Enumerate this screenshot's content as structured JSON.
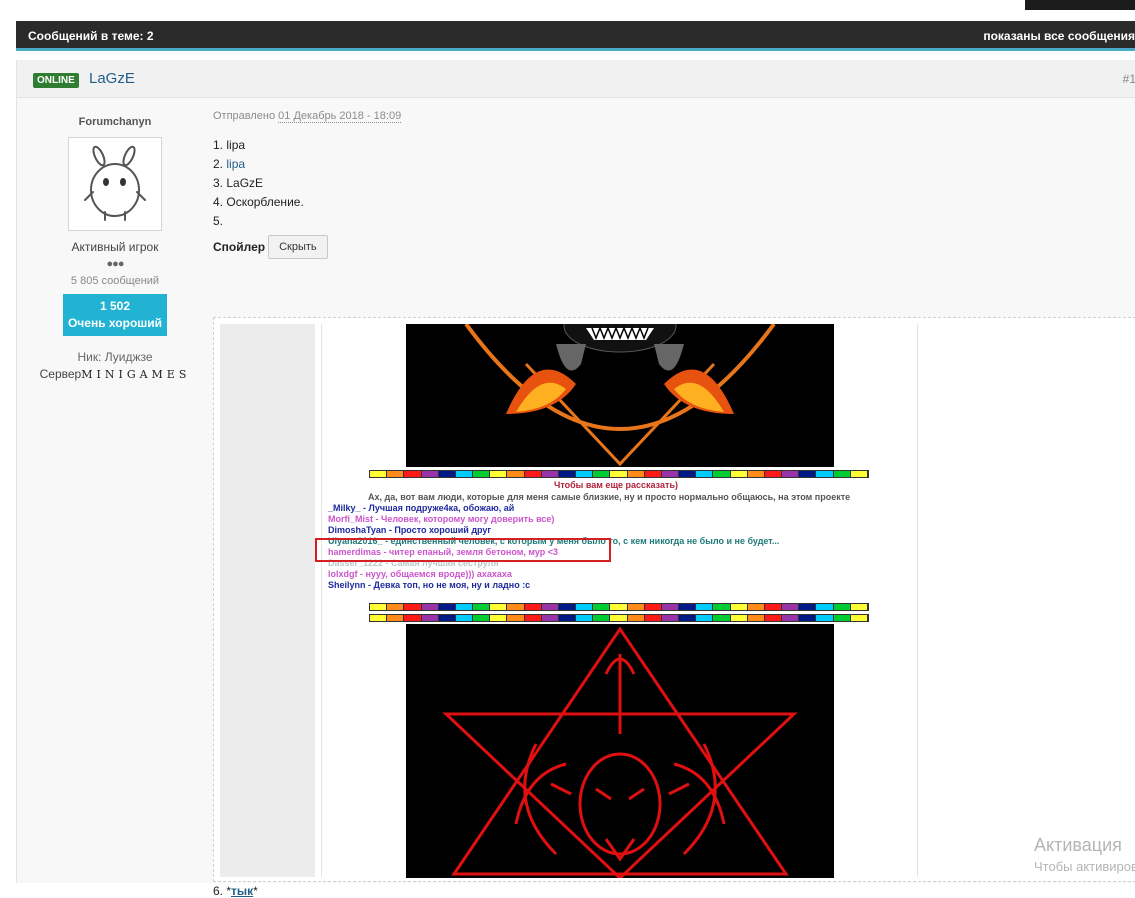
{
  "topbar": {
    "count_label": "Сообщений в теме: 2",
    "shown_label": "показаны все сообщения"
  },
  "post": {
    "status_badge": "ONLINE",
    "author": "LaGzE",
    "number": "#1",
    "sidebar": {
      "group": "Forumchanyn",
      "rank": "Активный игрок",
      "pips": "●●●",
      "posts_count": "5 805 сообщений",
      "reputation_value": "1 502",
      "reputation_label": "Очень хороший",
      "nick_label": "Ник:",
      "nick_value": "Луиджзе",
      "server_label": "Сервер",
      "server_value": "MINIGAMES"
    },
    "posted_label": "Отправлено",
    "posted_date": "01 Декабрь 2018 - 18:09",
    "list": {
      "item1_num": "1.",
      "item1_text": "lipa",
      "item2_num": "2.",
      "item2_text": "lipa",
      "item3_num": "3.",
      "item3_text": "LaGzE",
      "item4_num": "4.",
      "item4_text": "Оскорбление.",
      "item5_num": "5."
    },
    "spoiler_label": "Спойлер",
    "hide_button": "Скрыть",
    "spoiler": {
      "heading": "Чтобы вам еще рассказать)",
      "intro": "Ах, да, вот вам люди, которые для меня самые близкие, ну и просто нормально общаюсь, на этом проекте",
      "line1": "_Milky_ - Лучшая подруже4ка, обожаю, ай",
      "line2": "Morfi_Mist - Человек, которому могу доверить все)",
      "line3": "DimoshaTyan - Просто хороший друг",
      "line4": "Uiyana2016_ - единственный человек, с которым у меня было то, с кем никогда не было и не будет...",
      "line5": "hamerdimas - читер епаный, земля бетоном, мур <3",
      "line6": "Dasser_1222 - Самая лучшая сеструля",
      "line7": "lolxdgf - нууу, общаемся вроде))) ахахаха",
      "line8": "Sheilynn - Девка топ, но не моя, ну и ладно :c"
    },
    "after_prefix": "6. *",
    "after_link": "тык",
    "after_suffix": "*"
  },
  "watermark": {
    "line1": "Активация",
    "line2": "Чтобы активировать"
  },
  "colors": {
    "accent": "#4aa8c8",
    "online": "#2f7d32",
    "reputation": "#22b3d2",
    "link": "#1f5f8a",
    "highlight": "#d42020",
    "rainbow": [
      "#ffff33",
      "#ff8c1a",
      "#ff1a1a",
      "#9933aa",
      "#001a88",
      "#00ccff",
      "#00cc33",
      "#ff99cc"
    ]
  }
}
